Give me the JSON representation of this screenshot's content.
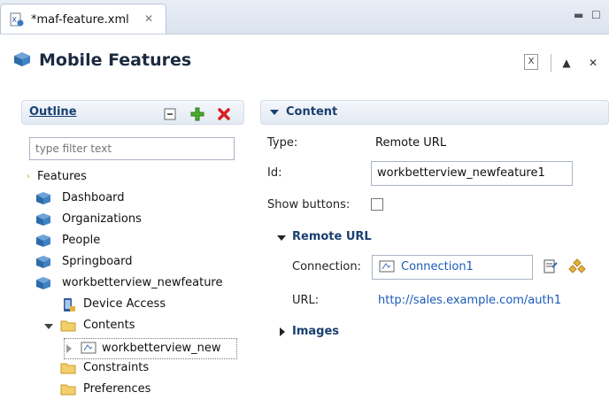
{
  "tab": {
    "title": "*maf-feature.xml",
    "close": "✕"
  },
  "window": {
    "minimize": "▭",
    "maximize": "◻"
  },
  "header": {
    "title": "Mobile Features"
  },
  "outline": {
    "title": "Outline",
    "filter_placeholder": "type filter text",
    "tree": {
      "root": "Features",
      "features": [
        "Dashboard",
        "Organizations",
        "People",
        "Springboard",
        "workbetterview_newfeature"
      ],
      "children": {
        "device_access": "Device Access",
        "contents": "Contents",
        "content_item": "workbetterview_new",
        "constraints": "Constraints",
        "preferences": "Preferences"
      }
    }
  },
  "content": {
    "title": "Content",
    "type_label": "Type:",
    "type_value": "Remote URL",
    "id_label": "Id:",
    "id_value": "workbetterview_newfeature1",
    "show_buttons_label": "Show buttons:",
    "remote_url": {
      "title": "Remote URL",
      "connection_label": "Connection:",
      "connection_value": "Connection1",
      "url_label": "URL:",
      "url_value": "http://sales.example.com/auth1"
    },
    "images_label": "Images"
  },
  "colors": {
    "accent": "#1a3f70",
    "link": "#1a5bb8",
    "folder": "#e6b33c",
    "cube": "#3b7bbf"
  }
}
